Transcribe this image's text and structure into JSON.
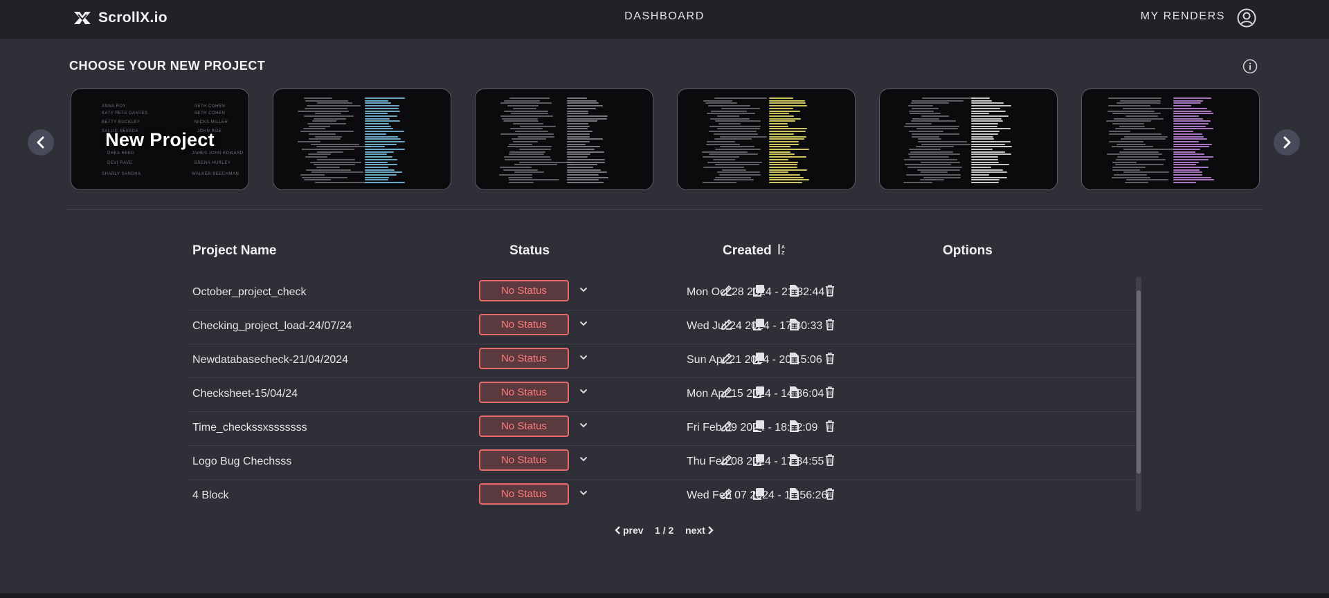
{
  "app": {
    "name": "ScrollX.io"
  },
  "nav": {
    "center": "DASHBOARD",
    "right": "MY RENDERS"
  },
  "section": {
    "title": "CHOOSE YOUR NEW PROJECT"
  },
  "templates": [
    {
      "label": "New Project"
    },
    {
      "label": ""
    },
    {
      "label": ""
    },
    {
      "label": ""
    },
    {
      "label": ""
    },
    {
      "label": ""
    }
  ],
  "table": {
    "headers": {
      "name": "Project Name",
      "status": "Status",
      "created": "Created",
      "options": "Options"
    },
    "rows": [
      {
        "name": "October_project_check",
        "status": "No Status",
        "created": "Mon Oct 28 2024 - 21:32:44"
      },
      {
        "name": "Checking_project_load-24/07/24",
        "status": "No Status",
        "created": "Wed Jul 24 2024 - 17:30:33"
      },
      {
        "name": "Newdatabasecheck-21/04/2024",
        "status": "No Status",
        "created": "Sun Apr 21 2024 - 20:15:06"
      },
      {
        "name": "Checksheet-15/04/24",
        "status": "No Status",
        "created": "Mon Apr 15 2024 - 14:36:04"
      },
      {
        "name": "Time_checkssxsssssss",
        "status": "No Status",
        "created": "Fri Feb 09 2024 - 18:12:09"
      },
      {
        "name": "Logo Bug Chechsss",
        "status": "No Status",
        "created": "Thu Feb 08 2024 - 17:34:55"
      },
      {
        "name": "4 Block",
        "status": "No Status",
        "created": "Wed Feb 07 2024 - 18:56:26"
      }
    ]
  },
  "pagination": {
    "prev": "prev",
    "page": "1 / 2",
    "next": "next"
  },
  "colors": {
    "status_border": "#e86a6a",
    "status_text": "#ff7b7b",
    "background": "#2e2f37",
    "topbar": "#212227"
  },
  "icons": [
    "logo-x-icon",
    "user-account-icon",
    "info-icon",
    "chevron-left-icon",
    "chevron-right-icon",
    "sort-icon",
    "chevron-down-icon",
    "edit-icon",
    "duplicate-icon",
    "document-icon",
    "delete-icon"
  ]
}
